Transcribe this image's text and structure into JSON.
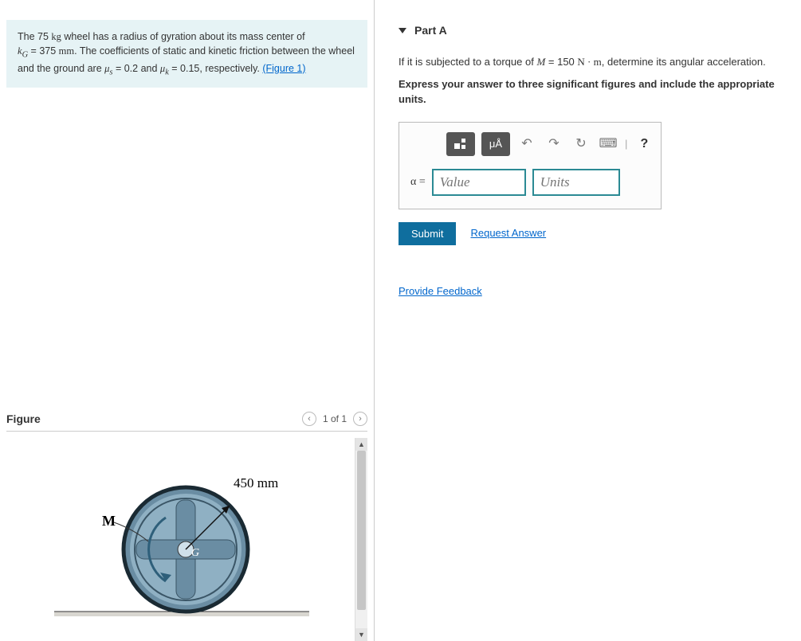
{
  "problem": {
    "mass_text_pre": "The 75 ",
    "mass_unit": "kg",
    "line1_post": " wheel has a radius of gyration about its mass center of",
    "kG_sym": "k",
    "kG_sub": "G",
    "kG_val": " = 375 ",
    "kG_unit": "mm",
    "line2_mid": ". The coefficients of static and kinetic friction between the wheel",
    "line3_pre": "and the ground are ",
    "mus_sym": "μ",
    "mus_sub": "s",
    "mus_val": " = 0.2 and ",
    "muk_sym": "μ",
    "muk_sub": "k",
    "muk_val": " = 0.15, respectively. ",
    "figure_link": "(Figure 1)"
  },
  "figure": {
    "title": "Figure",
    "nav_text": "1 of 1",
    "radius_label": "450 mm",
    "M_label": "M",
    "G_label": "G"
  },
  "partA": {
    "title": "Part A",
    "q_pre": "If it is subjected to a torque of ",
    "q_M": "M",
    "q_eq": " = 150 ",
    "q_unit": "N · m",
    "q_post": ", determine its angular acceleration.",
    "instruct": "Express your answer to three significant figures and include the appropriate units.",
    "toolbar": {
      "templ": "□",
      "mu": "μÅ",
      "undo": "↶",
      "redo": "↷",
      "reset": "↻",
      "kbd": "⌨",
      "help": "?"
    },
    "alpha": "α =",
    "value_ph": "Value",
    "units_ph": "Units",
    "submit": "Submit",
    "request": "Request Answer"
  },
  "feedback": "Provide Feedback"
}
